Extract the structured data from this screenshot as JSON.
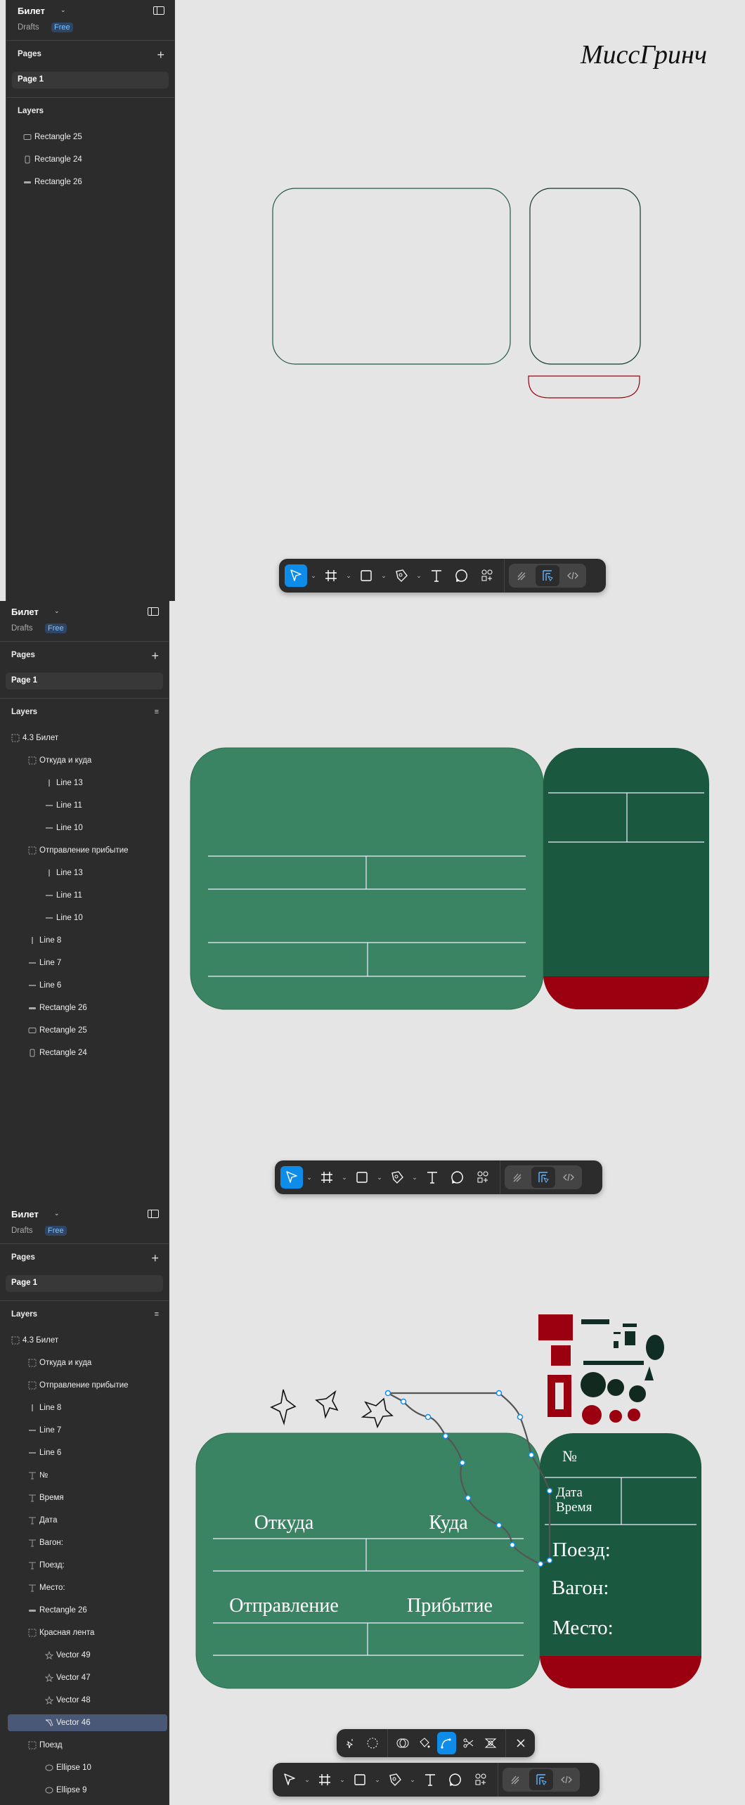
{
  "app": {
    "file_title": "Билет",
    "drafts_label": "Drafts",
    "plan_badge": "Free",
    "pages_heading": "Pages",
    "page_name": "Page 1",
    "layers_heading": "Layers"
  },
  "logo": {
    "text": "МиссГринч"
  },
  "colors": {
    "card_light": "#3a8464",
    "card_dark": "#1b5840",
    "ribbon_red": "#9a0010",
    "selection_blue": "#0d8ce9"
  },
  "panels": [
    {
      "layers": [
        {
          "label": "Rectangle 25",
          "icon": "rect",
          "level": 0
        },
        {
          "label": "Rectangle 24",
          "icon": "rect-tall",
          "level": 0
        },
        {
          "label": "Rectangle 26",
          "icon": "rect-flat",
          "level": 0
        }
      ]
    },
    {
      "layers": [
        {
          "label": "4.3 Билет",
          "icon": "frame",
          "level": 0
        },
        {
          "label": "Откуда и куда",
          "icon": "frame",
          "level": 1
        },
        {
          "label": "Line 13",
          "icon": "line-v",
          "level": 2
        },
        {
          "label": "Line 11",
          "icon": "line-h",
          "level": 2
        },
        {
          "label": "Line 10",
          "icon": "line-h",
          "level": 2
        },
        {
          "label": "Отправление прибытие",
          "icon": "frame",
          "level": 1
        },
        {
          "label": "Line 13",
          "icon": "line-v",
          "level": 2
        },
        {
          "label": "Line 11",
          "icon": "line-h",
          "level": 2
        },
        {
          "label": "Line 10",
          "icon": "line-h",
          "level": 2
        },
        {
          "label": "Line 8",
          "icon": "line-v",
          "level": 1
        },
        {
          "label": "Line 7",
          "icon": "line-h",
          "level": 1
        },
        {
          "label": "Line 6",
          "icon": "line-h",
          "level": 1
        },
        {
          "label": "Rectangle 26",
          "icon": "rect-flat",
          "level": 1
        },
        {
          "label": "Rectangle 25",
          "icon": "rect",
          "level": 1
        },
        {
          "label": "Rectangle 24",
          "icon": "rect-tall",
          "level": 1
        }
      ]
    },
    {
      "layers": [
        {
          "label": "4.3 Билет",
          "icon": "frame",
          "level": 0
        },
        {
          "label": "Откуда и куда",
          "icon": "frame",
          "level": 1
        },
        {
          "label": "Отправление прибытие",
          "icon": "frame",
          "level": 1
        },
        {
          "label": "Line 8",
          "icon": "line-v",
          "level": 1
        },
        {
          "label": "Line 7",
          "icon": "line-h",
          "level": 1
        },
        {
          "label": "Line 6",
          "icon": "line-h",
          "level": 1
        },
        {
          "label": "№",
          "icon": "text",
          "level": 1
        },
        {
          "label": "Время",
          "icon": "text",
          "level": 1
        },
        {
          "label": "Дата",
          "icon": "text",
          "level": 1
        },
        {
          "label": "Вагон:",
          "icon": "text",
          "level": 1
        },
        {
          "label": "Поезд:",
          "icon": "text",
          "level": 1
        },
        {
          "label": "Место:",
          "icon": "text",
          "level": 1
        },
        {
          "label": "Rectangle 26",
          "icon": "rect-flat",
          "level": 1
        },
        {
          "label": "Красная лента",
          "icon": "frame",
          "level": 1
        },
        {
          "label": "Vector 49",
          "icon": "star",
          "level": 2
        },
        {
          "label": "Vector 47",
          "icon": "star",
          "level": 2
        },
        {
          "label": "Vector 48",
          "icon": "star",
          "level": 2
        },
        {
          "label": "Vector 46",
          "icon": "pen-path",
          "level": 2,
          "selected": true
        },
        {
          "label": "Поезд",
          "icon": "frame",
          "level": 1
        },
        {
          "label": "Ellipse 10",
          "icon": "ellipse",
          "level": 2
        },
        {
          "label": "Ellipse 9",
          "icon": "ellipse",
          "level": 2
        }
      ]
    }
  ],
  "ticket": {
    "from": "Откуда",
    "to": "Куда",
    "departure": "Отправление",
    "arrival": "Прибытие",
    "number": "№",
    "date": "Дата",
    "time": "Время",
    "train": "Поезд:",
    "car": "Вагон:",
    "seat": "Место:"
  },
  "toolbar": {
    "tools": [
      "move-icon",
      "frame-icon",
      "rectangle-icon",
      "pen-icon",
      "text-icon",
      "comment-icon",
      "assets-icon"
    ],
    "modes": [
      "draw-mode-icon",
      "design-mode-icon",
      "dev-mode-icon"
    ],
    "active_mode": "design-mode-icon"
  },
  "vector_toolbar": {
    "tools": [
      "multi-edit-icon",
      "lasso-icon",
      "boolean-icon",
      "paint-bucket-icon",
      "bend-tool-icon",
      "cut-icon",
      "shape-builder-icon",
      "close-icon"
    ],
    "active": "bend-tool-icon"
  }
}
